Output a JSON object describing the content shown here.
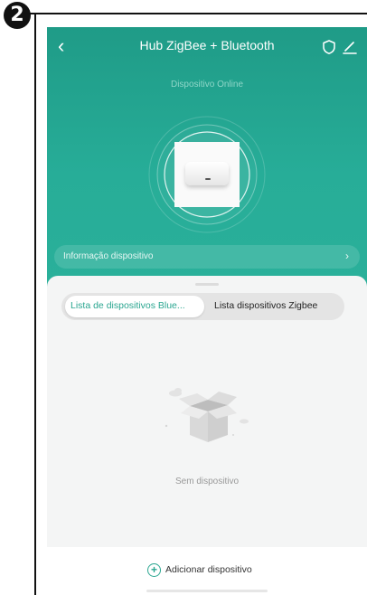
{
  "step": {
    "number": "2"
  },
  "header": {
    "back_icon": "chevron-left-icon",
    "title": "Hub ZigBee + Bluetooth",
    "shield_icon": "shield-icon",
    "edit_icon": "edit-pencil-icon"
  },
  "device": {
    "status": "Dispositivo Online",
    "image": "zigbee-hub-photo"
  },
  "info_bar": {
    "label": "Informação dispositivo",
    "chevron": "›"
  },
  "tabs": [
    {
      "label": "Lista de dispositivos  Blue...",
      "active": true
    },
    {
      "label": "Lista dispositivos Zigbee",
      "active": false
    }
  ],
  "empty_state": {
    "icon": "empty-box-icon",
    "text": "Sem dispositivo"
  },
  "footer": {
    "add_icon": "plus-circle-icon",
    "add_label": "Adicionar dispositivo"
  },
  "colors": {
    "accent": "#2aa690",
    "header_bg": "#27ad98"
  }
}
